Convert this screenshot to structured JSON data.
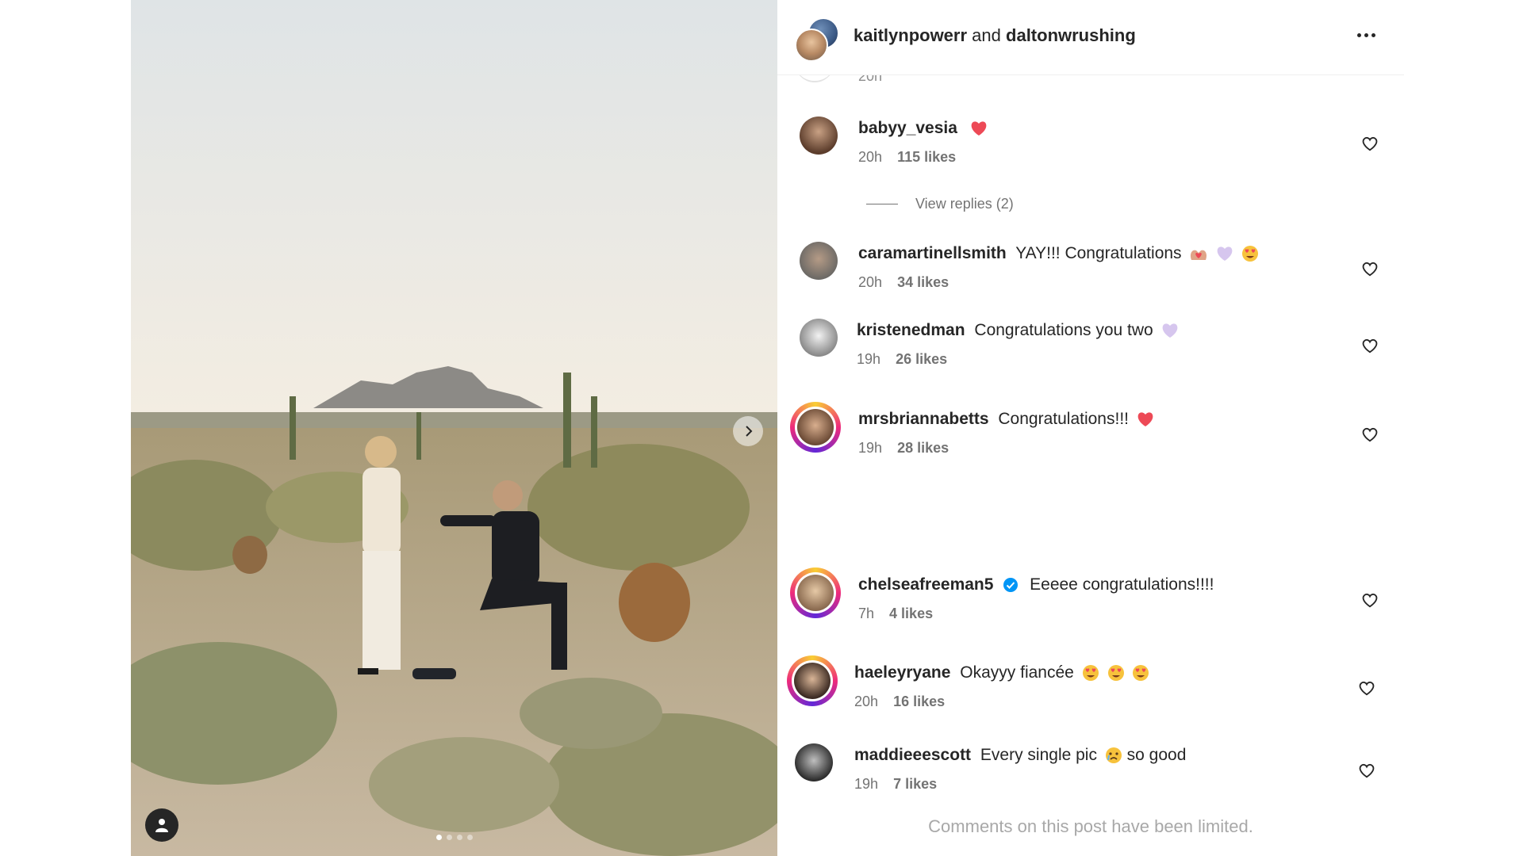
{
  "post": {
    "authors": [
      "kaitlynpowerr",
      "daltonwrushing"
    ],
    "joiner": "and",
    "photo_alt_semantic": "proposal-photo",
    "carousel": {
      "count": 4,
      "active": 1
    }
  },
  "partial_comment": {
    "time": "20h"
  },
  "comments": [
    {
      "user": "babyy_vesia",
      "text": "",
      "emoji": [
        "heart"
      ],
      "time": "20h",
      "likes": "115 likes",
      "replies": "View replies (2)"
    },
    {
      "user": "caramartinellsmith",
      "text": "YAY!!! Congratulations",
      "emoji": [
        "heart-hands",
        "light-purple-heart",
        "heart-eyes"
      ],
      "time": "20h",
      "likes": "34 likes"
    },
    {
      "user": "kristenedman",
      "text": "Congratulations you two",
      "emoji": [
        "light-purple-heart"
      ],
      "time": "19h",
      "likes": "26 likes"
    },
    {
      "user": "mrsbriannabetts",
      "text": "Congratulations!!!",
      "emoji": [
        "heart"
      ],
      "time": "19h",
      "likes": "28 likes"
    },
    {
      "user": "chelseafreeman5",
      "verified": true,
      "text": "Eeeee congratulations!!!!",
      "emoji": [],
      "time": "7h",
      "likes": "4 likes"
    },
    {
      "user": "haeleyryane",
      "text": "Okayyy fiancée",
      "emoji": [
        "heart-eyes",
        "heart-eyes",
        "heart-eyes"
      ],
      "time": "20h",
      "likes": "16 likes"
    },
    {
      "user": "maddieeescott",
      "text": "Every single pic",
      "text_after": "so good",
      "emoji": [
        "crying-face"
      ],
      "time": "19h",
      "likes": "7 likes"
    }
  ],
  "footer": {
    "limited_text": "Comments on this post have been limited."
  },
  "colors": {
    "heart": "#ed4956",
    "verified": "#0095f6",
    "muted": "#737373",
    "limited": "#a8a8a8"
  }
}
